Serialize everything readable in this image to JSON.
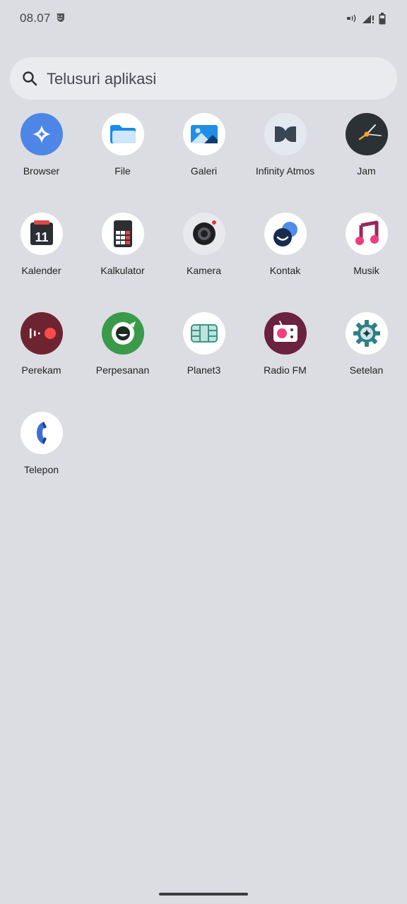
{
  "status_bar": {
    "time": "08.07",
    "icons": [
      "smiley-notification-icon",
      "nfc-icon",
      "signal-icon",
      "battery-icon"
    ]
  },
  "search": {
    "placeholder": "Telusuri aplikasi",
    "icon": "search-icon"
  },
  "apps": [
    {
      "label": "Browser",
      "icon": "browser-icon"
    },
    {
      "label": "File",
      "icon": "files-icon"
    },
    {
      "label": "Galeri",
      "icon": "gallery-icon"
    },
    {
      "label": "Infinity Atmos",
      "icon": "dolby-atmos-icon"
    },
    {
      "label": "Jam",
      "icon": "clock-icon"
    },
    {
      "label": "Kalender",
      "icon": "calendar-icon"
    },
    {
      "label": "Kalkulator",
      "icon": "calculator-icon"
    },
    {
      "label": "Kamera",
      "icon": "camera-icon"
    },
    {
      "label": "Kontak",
      "icon": "contacts-icon"
    },
    {
      "label": "Musik",
      "icon": "music-icon"
    },
    {
      "label": "Perekam",
      "icon": "recorder-icon"
    },
    {
      "label": "Perpesanan",
      "icon": "messaging-icon"
    },
    {
      "label": "Planet3",
      "icon": "sim-card-icon"
    },
    {
      "label": "Radio FM",
      "icon": "radio-icon"
    },
    {
      "label": "Setelan",
      "icon": "settings-icon"
    },
    {
      "label": "Telepon",
      "icon": "phone-icon"
    }
  ],
  "calendar_day": "11",
  "colors": {
    "background": "#dcdde2",
    "search_bg": "#eaebef",
    "browser_blue": "#4d86e6",
    "messaging_green": "#3a9a4a",
    "recorder_red": "#6e2430",
    "radio_plum": "#6b2140",
    "clock_dark": "#2c3136"
  }
}
